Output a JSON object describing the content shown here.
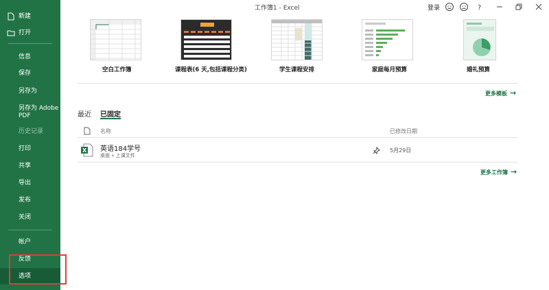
{
  "window": {
    "title": "工作簿1  -  Excel",
    "signin": "登录"
  },
  "sidebar": {
    "new": "新建",
    "open": "打开",
    "info": "信息",
    "save": "保存",
    "save_as": "另存为",
    "save_as_pdf": "另存为 Adobe PDF",
    "history": "历史记录",
    "print": "打印",
    "share": "共享",
    "export": "导出",
    "publish": "发布",
    "close": "关闭",
    "account": "帐户",
    "feedback": "反馈",
    "options": "选项"
  },
  "templates": [
    {
      "label": "空白工作簿"
    },
    {
      "label": "课程表(6 天,包括课程分类)"
    },
    {
      "label": "学生课程安排"
    },
    {
      "label": "家庭每月预算"
    },
    {
      "label": "婚礼预算"
    }
  ],
  "more_templates": "更多模板",
  "tabs": {
    "recent": "最近",
    "pinned": "已固定"
  },
  "list": {
    "col_name": "名称",
    "col_modified": "已修改日期",
    "files": [
      {
        "name": "英语184学号",
        "path": "桌面 » 上课文件",
        "date": "5月29日"
      }
    ]
  },
  "more_workbooks": "更多工作簿",
  "colors": {
    "accent": "#217346",
    "sidebar_selected": "#185c37",
    "highlight": "#e03b3b"
  }
}
